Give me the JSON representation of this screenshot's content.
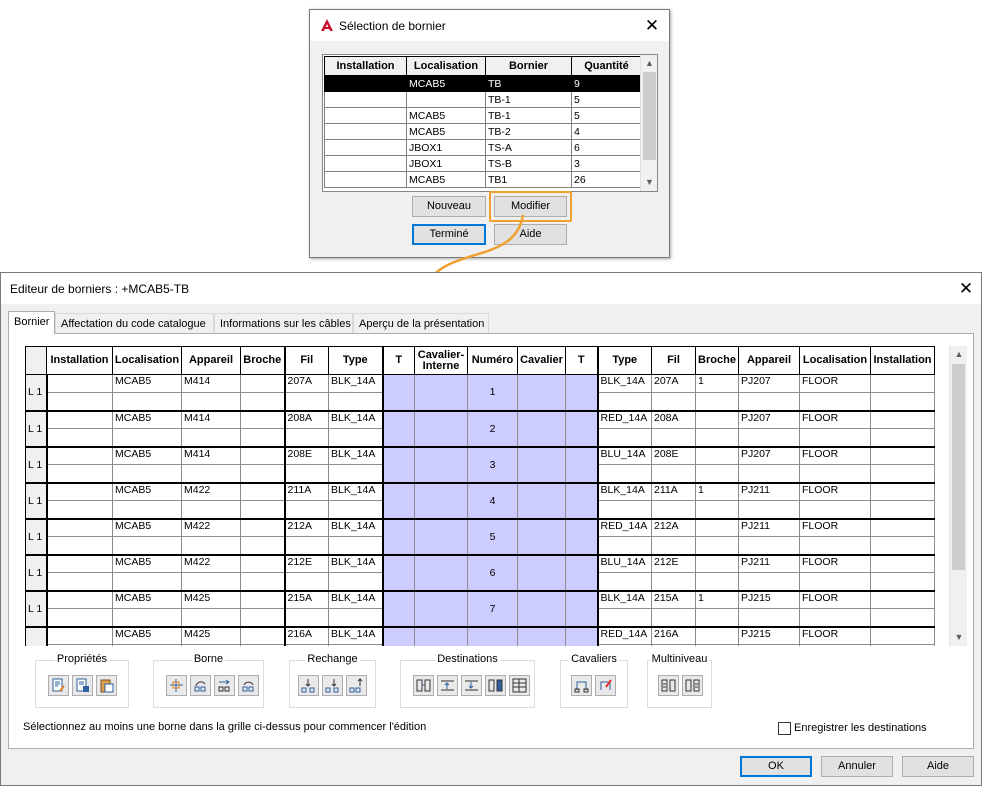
{
  "dialog_selection": {
    "title": "Sélection de bornier",
    "columns": [
      "Installation",
      "Localisation",
      "Bornier",
      "Quantité"
    ],
    "rows": [
      [
        "",
        "MCAB5",
        "TB",
        "9"
      ],
      [
        "",
        "",
        "TB-1",
        "5"
      ],
      [
        "",
        "MCAB5",
        "TB-1",
        "5"
      ],
      [
        "",
        "MCAB5",
        "TB-2",
        "4"
      ],
      [
        "",
        "JBOX1",
        "TS-A",
        "6"
      ],
      [
        "",
        "JBOX1",
        "TS-B",
        "3"
      ],
      [
        "",
        "MCAB5",
        "TB1",
        "26"
      ]
    ],
    "buttons": {
      "nouveau": "Nouveau",
      "modifier": "Modifier",
      "termine": "Terminé",
      "aide": "Aide"
    }
  },
  "editor": {
    "title": "Editeur de borniers : +MCAB5-TB",
    "tabs": [
      "Bornier",
      "Affectation du code catalogue",
      "Informations sur les câbles",
      "Aperçu de la présentation"
    ],
    "columns": [
      "",
      "Installation",
      "Localisation",
      "Appareil",
      "Broche",
      "Fil",
      "Type",
      "T",
      "Cavalier-\nInterne",
      "Numéro",
      "Cavalier",
      "T",
      "Type",
      "Fil",
      "Broche",
      "Appareil",
      "Localisation",
      "Installation"
    ],
    "rows": [
      {
        "label": "L 1",
        "loc": "MCAB5",
        "app": "M414",
        "broche": "",
        "fil": "207A",
        "type": "BLK_14A",
        "num": "1",
        "rtype": "BLK_14A",
        "rfil": "207A",
        "rbroche": "1",
        "rapp": "PJ207",
        "rloc": "FLOOR"
      },
      {
        "label": "L 1",
        "loc": "MCAB5",
        "app": "M414",
        "broche": "",
        "fil": "208A",
        "type": "BLK_14A",
        "num": "2",
        "rtype": "RED_14A",
        "rfil": "208A",
        "rbroche": "",
        "rapp": "PJ207",
        "rloc": "FLOOR"
      },
      {
        "label": "L 1",
        "loc": "MCAB5",
        "app": "M414",
        "broche": "",
        "fil": "208E",
        "type": "BLK_14A",
        "num": "3",
        "rtype": "BLU_14A",
        "rfil": "208E",
        "rbroche": "",
        "rapp": "PJ207",
        "rloc": "FLOOR"
      },
      {
        "label": "L 1",
        "loc": "MCAB5",
        "app": "M422",
        "broche": "",
        "fil": "211A",
        "type": "BLK_14A",
        "num": "4",
        "rtype": "BLK_14A",
        "rfil": "211A",
        "rbroche": "1",
        "rapp": "PJ211",
        "rloc": "FLOOR"
      },
      {
        "label": "L 1",
        "loc": "MCAB5",
        "app": "M422",
        "broche": "",
        "fil": "212A",
        "type": "BLK_14A",
        "num": "5",
        "rtype": "RED_14A",
        "rfil": "212A",
        "rbroche": "",
        "rapp": "PJ211",
        "rloc": "FLOOR"
      },
      {
        "label": "L 1",
        "loc": "MCAB5",
        "app": "M422",
        "broche": "",
        "fil": "212E",
        "type": "BLK_14A",
        "num": "6",
        "rtype": "BLU_14A",
        "rfil": "212E",
        "rbroche": "",
        "rapp": "PJ211",
        "rloc": "FLOOR"
      },
      {
        "label": "L 1",
        "loc": "MCAB5",
        "app": "M425",
        "broche": "",
        "fil": "215A",
        "type": "BLK_14A",
        "num": "7",
        "rtype": "BLK_14A",
        "rfil": "215A",
        "rbroche": "1",
        "rapp": "PJ215",
        "rloc": "FLOOR"
      },
      {
        "label": "",
        "loc": "MCAB5",
        "app": "M425",
        "broche": "",
        "fil": "216A",
        "type": "BLK_14A",
        "num": "",
        "rtype": "RED_14A",
        "rfil": "216A",
        "rbroche": "",
        "rapp": "PJ215",
        "rloc": "FLOOR"
      }
    ],
    "groups": {
      "proprietes": "Propriétés",
      "borne": "Borne",
      "rechange": "Rechange",
      "destinations": "Destinations",
      "cavaliers": "Cavaliers",
      "multiniveau": "Multiniveau"
    },
    "status_text": "Sélectionnez au moins une borne dans la grille ci-dessus pour commencer l'édition",
    "checkbox_label": "Enregistrer les destinations",
    "buttons": {
      "ok": "OK",
      "annuler": "Annuler",
      "aide": "Aide"
    }
  },
  "colors": {
    "accent_orange": "#f0a030",
    "selected_row": "#000000",
    "cavalier_blue": "#ccccff",
    "default_button": "#0078d7"
  }
}
